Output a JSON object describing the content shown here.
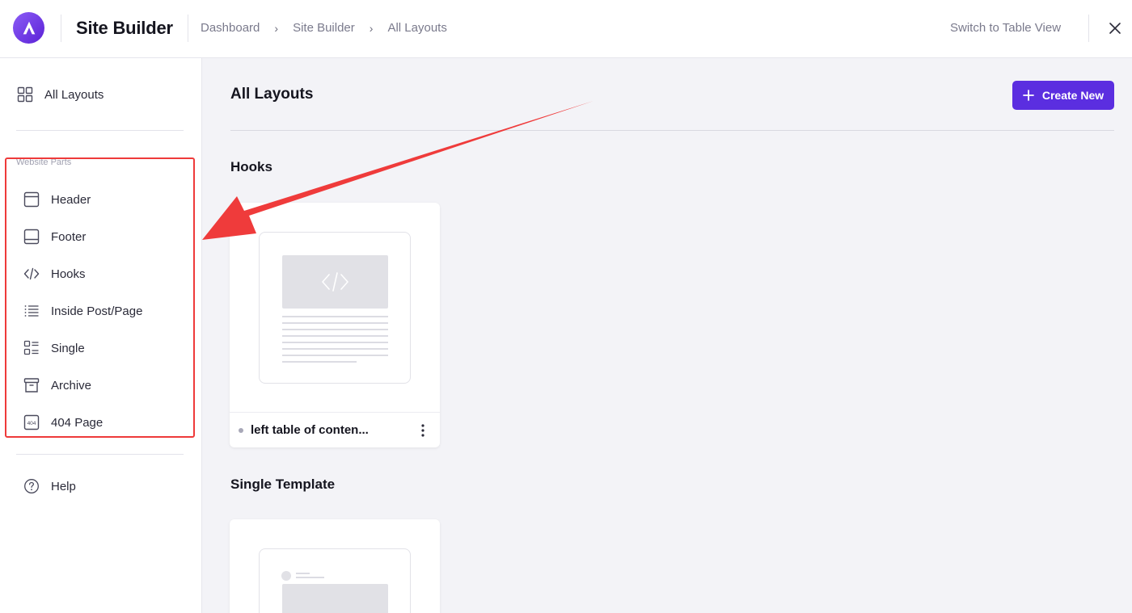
{
  "header": {
    "title": "Site Builder",
    "breadcrumb": [
      "Dashboard",
      "Site Builder",
      "All Layouts"
    ],
    "switch_view_label": "Switch to Table View"
  },
  "sidebar": {
    "top_item": "All Layouts",
    "section_label": "Website Parts",
    "items": [
      {
        "label": "Header",
        "icon": "header-icon"
      },
      {
        "label": "Footer",
        "icon": "footer-icon"
      },
      {
        "label": "Hooks",
        "icon": "code-icon"
      },
      {
        "label": "Inside Post/Page",
        "icon": "list-icon"
      },
      {
        "label": "Single",
        "icon": "single-icon"
      },
      {
        "label": "Archive",
        "icon": "archive-icon"
      },
      {
        "label": "404 Page",
        "icon": "404-icon"
      }
    ],
    "help_label": "Help"
  },
  "main": {
    "title": "All Layouts",
    "create_button_label": "Create New",
    "sections": [
      {
        "title": "Hooks",
        "cards": [
          {
            "name": "left table of conten..."
          }
        ]
      },
      {
        "title": "Single Template",
        "cards": [
          {
            "name": ""
          }
        ]
      }
    ]
  },
  "colors": {
    "accent": "#5b2ee0",
    "highlight": "#ee3a3a",
    "background": "#f3f3f7"
  }
}
